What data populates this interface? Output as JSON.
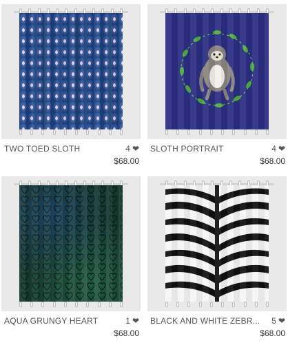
{
  "products": [
    {
      "title": "TWO TOED SLOTH",
      "likes": "4",
      "price": "$68.00",
      "heart_icon": "heart-icon"
    },
    {
      "title": "SLOTH PORTRAIT",
      "likes": "4",
      "price": "$68.00",
      "heart_icon": "heart-icon"
    },
    {
      "title": "AQUA GRUNGY HEART",
      "likes": "1",
      "price": "$68.00",
      "heart_icon": "heart-icon"
    },
    {
      "title": "BLACK AND WHITE ZEBR...",
      "likes": "5",
      "price": "$68.00",
      "heart_icon": "heart-icon"
    }
  ],
  "colors": {
    "sloth_pattern_bg": "#1f3e78",
    "sloth_portrait_bg": "#2b2f82",
    "aqua_bg": "#143a2e",
    "leaf_green": "#4fae3a"
  }
}
